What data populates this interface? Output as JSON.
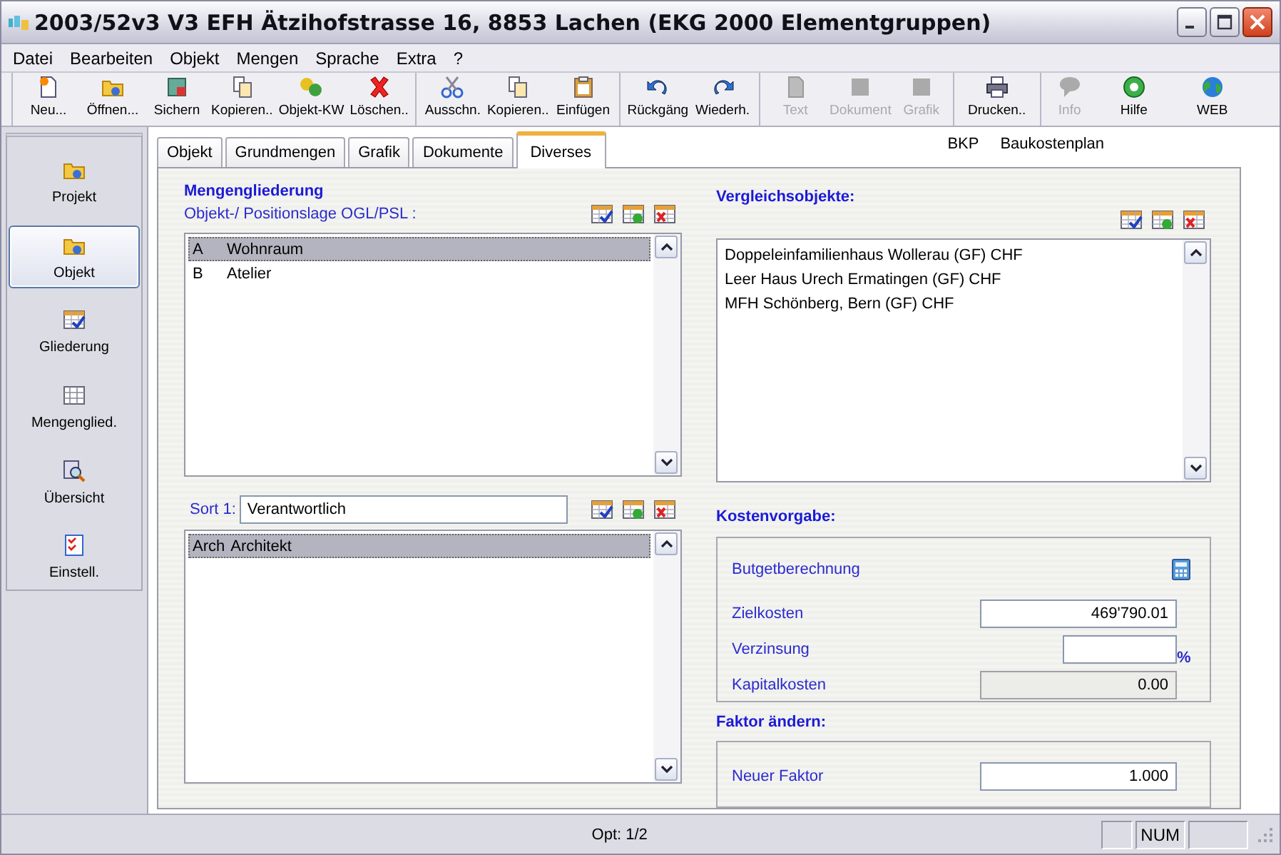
{
  "window": {
    "title": "2003/52v3 V3 EFH Ätzihofstrasse 16, 8853 Lachen (EKG 2000 Elementgruppen)"
  },
  "menu": [
    "Datei",
    "Bearbeiten",
    "Objekt",
    "Mengen",
    "Sprache",
    "Extra",
    "?"
  ],
  "toolbar": [
    [
      {
        "label": "Neu...",
        "disabled": false
      },
      {
        "label": "Öffnen...",
        "disabled": false
      },
      {
        "label": "Sichern",
        "disabled": false
      },
      {
        "label": "Kopieren..",
        "disabled": false
      },
      {
        "label": "Objekt-KW",
        "disabled": false
      },
      {
        "label": "Löschen..",
        "disabled": false
      }
    ],
    [
      {
        "label": "Ausschn.",
        "disabled": false
      },
      {
        "label": "Kopieren..",
        "disabled": false
      },
      {
        "label": "Einfügen",
        "disabled": false
      }
    ],
    [
      {
        "label": "Rückgäng",
        "disabled": false
      },
      {
        "label": "Wiederh.",
        "disabled": false
      }
    ],
    [
      {
        "label": "Text",
        "disabled": true
      },
      {
        "label": "Dokument",
        "disabled": true
      },
      {
        "label": "Grafik",
        "disabled": true
      }
    ],
    [
      {
        "label": "Drucken..",
        "disabled": false
      }
    ],
    [
      {
        "label": "Info",
        "disabled": true
      },
      {
        "label": "Hilfe",
        "disabled": false
      },
      {
        "label": "WEB",
        "disabled": false
      }
    ]
  ],
  "sidebar": {
    "items": [
      {
        "label": "Projekt",
        "selected": false
      },
      {
        "label": "Objekt",
        "selected": true
      },
      {
        "label": "Gliederung",
        "selected": false
      },
      {
        "label": "Mengenglied.",
        "selected": false
      },
      {
        "label": "Übersicht",
        "selected": false
      },
      {
        "label": "Einstell.",
        "selected": false
      }
    ]
  },
  "tabs": [
    {
      "label": "Objekt",
      "selected": false
    },
    {
      "label": "Grundmengen",
      "selected": false
    },
    {
      "label": "Grafik",
      "selected": false
    },
    {
      "label": "Dokumente",
      "selected": false
    },
    {
      "label": "Diverses",
      "selected": true
    }
  ],
  "header": {
    "code": "BKP",
    "name": "Baukostenplan"
  },
  "mengengliederung": {
    "title": "Mengengliederung",
    "subtitle": "Objekt-/ Positionslage OGL/PSL :",
    "rows": [
      {
        "code": "A",
        "name": "Wohnraum",
        "selected": true
      },
      {
        "code": "B",
        "name": "Atelier",
        "selected": false
      }
    ]
  },
  "sort": {
    "label": "Sort 1:",
    "value": "Verantwortlich",
    "rows": [
      {
        "code": "Arch",
        "name": "Architekt",
        "selected": true
      }
    ]
  },
  "vergleichsobjekte": {
    "title": "Vergleichsobjekte:",
    "rows": [
      {
        "name": "Doppeleinfamilienhaus Wollerau (GF) CHF",
        "selected": false
      },
      {
        "name": "Leer Haus Urech Ermatingen (GF) CHF",
        "selected": false
      },
      {
        "name": "MFH Schönberg, Bern (GF) CHF",
        "selected": false
      }
    ]
  },
  "kostenvorgabe": {
    "title": "Kostenvorgabe:",
    "link": "Butgetberechnung",
    "fields": [
      {
        "label": "Zielkosten",
        "value": "469'790.01",
        "disabled": false
      },
      {
        "label": "Verzinsung",
        "unit": "%",
        "disabled": false
      },
      {
        "label": "Kapitalkosten",
        "value": "0.00",
        "disabled": true
      }
    ]
  },
  "faktor": {
    "title": "Faktor ändern:",
    "fields": [
      {
        "label": "Neuer Faktor",
        "value": "1.000",
        "disabled": false
      }
    ]
  },
  "status_bar": {
    "text": "Opt: 1/2",
    "indicator": "NUM"
  }
}
